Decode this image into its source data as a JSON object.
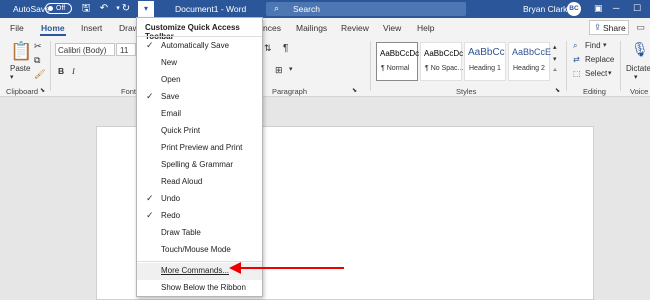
{
  "titlebar": {
    "autosave_label": "AutoSave",
    "autosave_state": "Off",
    "document_title": "Document1  -  Word",
    "search_label": "Search",
    "user_name": "Bryan Clark",
    "user_initials": "BC",
    "accent_color": "#2b579a"
  },
  "tabs": {
    "file": "File",
    "home": "Home",
    "insert": "Insert",
    "draw": "Draw",
    "references": "nces",
    "mailings": "Mailings",
    "review": "Review",
    "view": "View",
    "help": "Help",
    "share": "Share"
  },
  "ribbon": {
    "paste": "Paste",
    "clipboard": "Clipboard",
    "font_name": "Calibri (Body)",
    "font_size": "11",
    "font_group": "Font",
    "bold": "B",
    "italic": "I",
    "paragraph": "Paragraph",
    "pilcrow": "¶",
    "styles_group": "Styles",
    "styles": [
      {
        "preview": "AaBbCcDc",
        "name": "¶ Normal"
      },
      {
        "preview": "AaBbCcDc",
        "name": "¶ No Spac..."
      },
      {
        "preview": "AaBbCc",
        "name": "Heading 1"
      },
      {
        "preview": "AaBbCcE",
        "name": "Heading 2"
      }
    ],
    "find": "Find",
    "replace": "Replace",
    "select": "Select",
    "editing": "Editing",
    "dictate": "Dictate",
    "voice": "Voice"
  },
  "qat_menu": {
    "title": "Customize Quick Access Toolbar",
    "items": [
      {
        "label": "Automatically Save",
        "checked": true
      },
      {
        "label": "New",
        "checked": false
      },
      {
        "label": "Open",
        "checked": false
      },
      {
        "label": "Save",
        "checked": true
      },
      {
        "label": "Email",
        "checked": false
      },
      {
        "label": "Quick Print",
        "checked": false
      },
      {
        "label": "Print Preview and Print",
        "checked": false
      },
      {
        "label": "Spelling & Grammar",
        "checked": false
      },
      {
        "label": "Read Aloud",
        "checked": false
      },
      {
        "label": "Undo",
        "checked": true
      },
      {
        "label": "Redo",
        "checked": true
      },
      {
        "label": "Draw Table",
        "checked": false
      },
      {
        "label": "Touch/Mouse Mode",
        "checked": false
      },
      {
        "label": "More Commands...",
        "checked": false
      },
      {
        "label": "Show Below the Ribbon",
        "checked": false
      }
    ],
    "check_glyph": "✓"
  },
  "annotation": {
    "arrow_color": "#e00000"
  }
}
